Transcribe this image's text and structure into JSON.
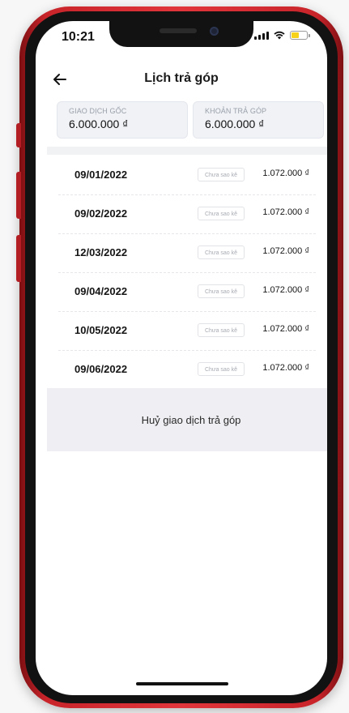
{
  "status_bar": {
    "time": "10:21"
  },
  "header": {
    "back_icon": "arrow-left-icon",
    "title": "Lịch trả góp"
  },
  "summary": {
    "original": {
      "label": "GIAO DỊCH GỐC",
      "value": "6.000.000 ₫"
    },
    "installment": {
      "label": "KHOẢN TRẢ GÓP",
      "value": "6.000.000 ₫"
    }
  },
  "schedule": [
    {
      "date": "09/01/2022",
      "status": "Chưa sao kê",
      "amount": "1.072.000 ₫"
    },
    {
      "date": "09/02/2022",
      "status": "Chưa sao kê",
      "amount": "1.072.000 ₫"
    },
    {
      "date": "12/03/2022",
      "status": "Chưa sao kê",
      "amount": "1.072.000 ₫"
    },
    {
      "date": "09/04/2022",
      "status": "Chưa sao kê",
      "amount": "1.072.000 ₫"
    },
    {
      "date": "10/05/2022",
      "status": "Chưa sao kê",
      "amount": "1.072.000 ₫"
    },
    {
      "date": "09/06/2022",
      "status": "Chưa sao kê",
      "amount": "1.072.000 ₫"
    }
  ],
  "actions": {
    "cancel_label": "Huỷ giao dịch trả góp"
  },
  "colors": {
    "frame": "#e0353b",
    "battery_fill": "#f7d21a",
    "card_bg": "#f0f2f6",
    "cancel_bg": "#efeff3"
  }
}
